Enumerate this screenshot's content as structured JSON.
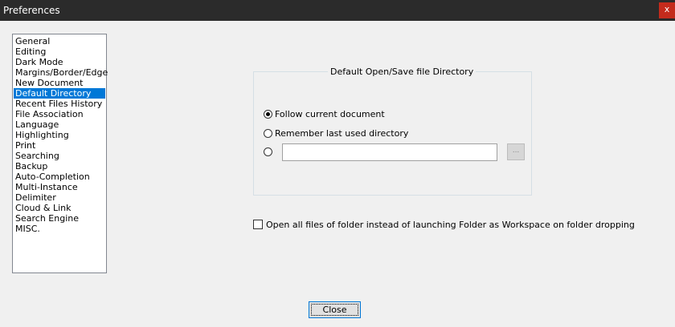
{
  "window": {
    "title": "Preferences",
    "close_glyph": "x",
    "close_icon": "close-icon"
  },
  "categories": {
    "items": [
      {
        "label": "General",
        "selected": false
      },
      {
        "label": "Editing",
        "selected": false
      },
      {
        "label": "Dark Mode",
        "selected": false
      },
      {
        "label": "Margins/Border/Edge",
        "selected": false
      },
      {
        "label": "New Document",
        "selected": false
      },
      {
        "label": "Default Directory",
        "selected": true
      },
      {
        "label": "Recent Files History",
        "selected": false
      },
      {
        "label": "File Association",
        "selected": false
      },
      {
        "label": "Language",
        "selected": false
      },
      {
        "label": "Highlighting",
        "selected": false
      },
      {
        "label": "Print",
        "selected": false
      },
      {
        "label": "Searching",
        "selected": false
      },
      {
        "label": "Backup",
        "selected": false
      },
      {
        "label": "Auto-Completion",
        "selected": false
      },
      {
        "label": "Multi-Instance",
        "selected": false
      },
      {
        "label": "Delimiter",
        "selected": false
      },
      {
        "label": "Cloud & Link",
        "selected": false
      },
      {
        "label": "Search Engine",
        "selected": false
      },
      {
        "label": "MISC.",
        "selected": false
      }
    ]
  },
  "directory": {
    "group_title": "Default Open/Save file Directory",
    "options": [
      {
        "label": "Follow current document",
        "checked": true
      },
      {
        "label": "Remember last used directory",
        "checked": false
      },
      {
        "label": "",
        "checked": false
      }
    ],
    "custom_path_value": "",
    "browse_label": "..."
  },
  "folder_drop": {
    "label": "Open all files of folder instead of launching Folder as Workspace on folder dropping",
    "checked": false
  },
  "footer": {
    "close_label": "Close"
  },
  "colors": {
    "titlebar": "#2b2b2b",
    "close_x": "#c42b1c",
    "selection": "#0078d7"
  }
}
